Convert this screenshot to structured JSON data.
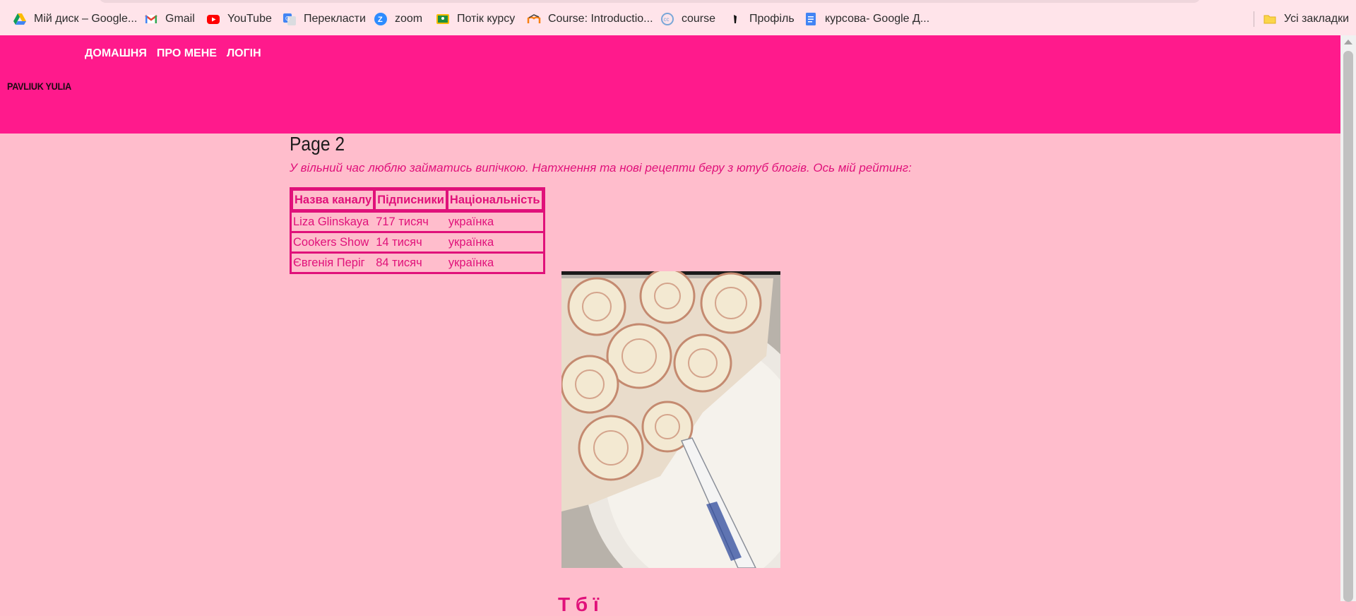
{
  "bookmarks": [
    {
      "label": "Мій диск – Google...",
      "icon": "google-drive-icon"
    },
    {
      "label": "Gmail",
      "icon": "gmail-icon"
    },
    {
      "label": "YouTube",
      "icon": "youtube-icon"
    },
    {
      "label": "Перекласти",
      "icon": "translate-icon"
    },
    {
      "label": "zoom",
      "icon": "zoom-icon"
    },
    {
      "label": "Потік курсу",
      "icon": "classroom-icon"
    },
    {
      "label": "Course: Introductio...",
      "icon": "moodle-icon"
    },
    {
      "label": "course",
      "icon": "course-icon"
    },
    {
      "label": "Профіль",
      "icon": "profile-icon"
    },
    {
      "label": "курсова- Google Д...",
      "icon": "google-docs-icon"
    }
  ],
  "all_bookmarks_label": "Усі закладки",
  "nav": {
    "home": "ДОМАШНЯ",
    "about": "ПРО МЕНЕ",
    "login": "ЛОГІН"
  },
  "brand": "PAVLIUK YULIA",
  "main": {
    "title": "Page 2",
    "intro": "У вільний час люблю займатись випічкою. Натхнення та нові рецепти беру з ютуб блогів. Ось мій рейтинг:",
    "table": {
      "headers": [
        "Назва каналу",
        "Підписники",
        "Національність"
      ],
      "rows": [
        [
          "Liza Glinskaya",
          "717 тисяч",
          "українка"
        ],
        [
          "Cookers Show",
          "14 тисяч",
          "українка"
        ],
        [
          "Євгенія Періг",
          "84 тисяч",
          "українка"
        ]
      ]
    },
    "partial_heading": "Т                б   ї"
  },
  "colors": {
    "header_bg": "#ff1a8c",
    "page_bg": "#ffbdcc",
    "accent_text": "#e0117a"
  }
}
